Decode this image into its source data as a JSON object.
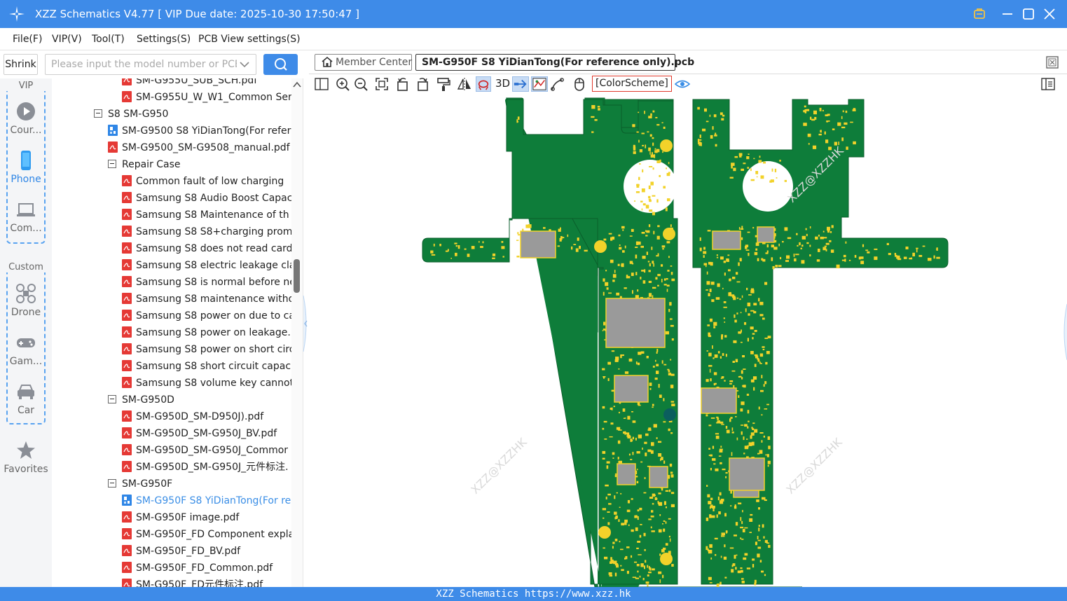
{
  "window": {
    "title": "XZZ Schematics V4.77 [ VIP Due date: 2025-10-30 17:50:47 ]"
  },
  "menu": [
    "File(F)",
    "VIP(V)",
    "Tool(T)",
    "Settings(S)",
    "PCB View settings(S)"
  ],
  "sidebar_controls": {
    "shrink_label": "Shrink",
    "search_placeholder": "Please input the model number or PCB"
  },
  "categories": {
    "vip_caption": "VIP",
    "custom_caption": "Custom",
    "vip_items": [
      {
        "label": "Cour...",
        "icon": "play-icon",
        "selected": false
      },
      {
        "label": "Phone",
        "icon": "phone-icon",
        "selected": true
      },
      {
        "label": "Com...",
        "icon": "laptop-icon",
        "selected": false
      }
    ],
    "custom_items": [
      {
        "label": "Drone",
        "icon": "drone-icon"
      },
      {
        "label": "Gam...",
        "icon": "gamepad-icon"
      },
      {
        "label": "Car",
        "icon": "car-icon"
      }
    ],
    "favorites_label": "Favorites"
  },
  "tree": [
    {
      "label": "SM-G955U_SUB_SCH.pdf",
      "type": "pdf",
      "level": 2
    },
    {
      "label": "SM-G955U_W_W1_Common Ser",
      "type": "pdf",
      "level": 2
    },
    {
      "label": "S8 SM-G950",
      "type": "folder",
      "level": 0
    },
    {
      "label": "SM-G9500 S8 YiDianTong(For refer",
      "type": "pcb",
      "level": 1
    },
    {
      "label": "SM-G9500_SM-G9508_manual.pdf",
      "type": "pdf",
      "level": 1
    },
    {
      "label": "Repair Case",
      "type": "folder",
      "level": 1
    },
    {
      "label": "Common fault of low charging",
      "type": "pdf",
      "level": 2
    },
    {
      "label": "Samsung S8 Audio Boost Capac",
      "type": "pdf",
      "level": 2
    },
    {
      "label": "Samsung S8 Maintenance of th",
      "type": "pdf",
      "level": 2
    },
    {
      "label": "Samsung S8 S8+charging prom",
      "type": "pdf",
      "level": 2
    },
    {
      "label": "Samsung S8 does not read card",
      "type": "pdf",
      "level": 2
    },
    {
      "label": "Samsung S8 electric leakage cla",
      "type": "pdf",
      "level": 2
    },
    {
      "label": "Samsung S8 is normal before ne",
      "type": "pdf",
      "level": 2
    },
    {
      "label": "Samsung S8 maintenance witho",
      "type": "pdf",
      "level": 2
    },
    {
      "label": "Samsung S8 power on due to ca",
      "type": "pdf",
      "level": 2
    },
    {
      "label": "Samsung S8 power on leakage.",
      "type": "pdf",
      "level": 2
    },
    {
      "label": "Samsung S8 power on short circ",
      "type": "pdf",
      "level": 2
    },
    {
      "label": "Samsung S8 short circuit capaci",
      "type": "pdf",
      "level": 2
    },
    {
      "label": "Samsung S8 volume key cannot",
      "type": "pdf",
      "level": 2
    },
    {
      "label": "SM-G950D",
      "type": "folder",
      "level": 1
    },
    {
      "label": "SM-G950D_SM-D950J).pdf",
      "type": "pdf",
      "level": 2
    },
    {
      "label": "SM-G950D_SM-G950J_BV.pdf",
      "type": "pdf",
      "level": 2
    },
    {
      "label": "SM-G950D_SM-G950J_Commor",
      "type": "pdf",
      "level": 2
    },
    {
      "label": "SM-G950D_SM-G950J_元件标注.",
      "type": "pdf",
      "level": 2
    },
    {
      "label": "SM-G950F",
      "type": "folder",
      "level": 1
    },
    {
      "label": "SM-G950F S8 YiDianTong(For re",
      "type": "pcb",
      "level": 2,
      "selected": true
    },
    {
      "label": "SM-G950F image.pdf",
      "type": "pdf",
      "level": 2
    },
    {
      "label": "SM-G950F_FD Component expla",
      "type": "pdf",
      "level": 2
    },
    {
      "label": "SM-G950F_FD_BV.pdf",
      "type": "pdf",
      "level": 2
    },
    {
      "label": "SM-G950F_FD_Common.pdf",
      "type": "pdf",
      "level": 2
    },
    {
      "label": "SM-G950F_FD元件标注.pdf",
      "type": "pdf",
      "level": 2
    }
  ],
  "tabs": {
    "member_center": "Member Center",
    "active_file": "SM-G950F S8 YiDianTong(For reference only).pcb"
  },
  "toolbar": {
    "label_3d": "3D",
    "color_scheme": "[ColorScheme]"
  },
  "watermark": "XZZ@XZZHK",
  "status": {
    "text": "XZZ Schematics https://www.xzz.hk"
  },
  "colors": {
    "accent": "#3e8be8",
    "pcb_green": "#0e7d3a",
    "pcb_pad": "#f2d22a"
  }
}
